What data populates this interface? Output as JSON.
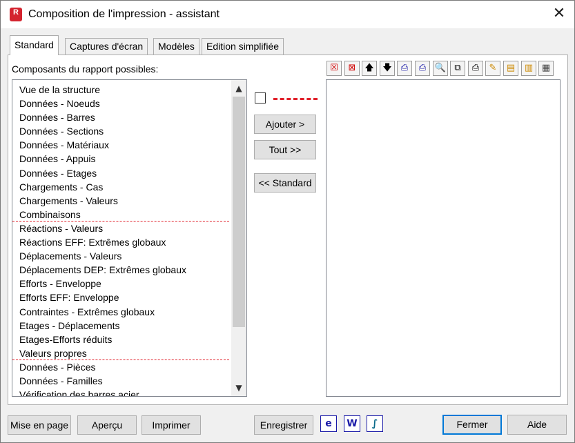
{
  "window": {
    "title": "Composition de l'impression - assistant",
    "app_icon_letter": "R",
    "close_glyph": "✕"
  },
  "tabs": [
    {
      "label": "Standard",
      "active": true
    },
    {
      "label": "Captures d'écran",
      "active": false
    },
    {
      "label": "Modèles",
      "active": false
    },
    {
      "label": "Edition simplifiée",
      "active": false
    }
  ],
  "available": {
    "label": "Composants du rapport possibles:",
    "items": [
      "Vue de la structure",
      "Données - Noeuds",
      "Données - Barres",
      "Données - Sections",
      "Données - Matériaux",
      "Données - Appuis",
      "Données - Etages",
      "Chargements - Cas",
      "Chargements - Valeurs",
      "Combinaisons",
      "Réactions - Valeurs",
      "Réactions EFF: Extrêmes globaux",
      "Déplacements - Valeurs",
      "Déplacements DEP: Extrêmes globaux",
      "Efforts - Enveloppe",
      "Efforts EFF: Enveloppe",
      "Contraintes - Extrêmes globaux",
      "Etages - Déplacements",
      "Etages-Efforts réduits",
      "Valeurs propres",
      "Données - Pièces",
      "Données - Familles",
      "Vérification des barres acier"
    ],
    "separator_after_indices": [
      9,
      19
    ]
  },
  "middle": {
    "add_label": "Ajouter >",
    "all_label": "Tout >>",
    "standard_label": "<< Standard"
  },
  "toolbar": {
    "icons": [
      {
        "name": "delete-icon",
        "glyph": "☒",
        "color": "#d00000"
      },
      {
        "name": "delete-all-icon",
        "glyph": "⊠",
        "color": "#d00000"
      },
      {
        "name": "move-up-icon",
        "glyph": "🡅",
        "color": "#000000"
      },
      {
        "name": "move-down-icon",
        "glyph": "🡇",
        "color": "#000000"
      },
      {
        "name": "print-selected-icon",
        "glyph": "⎙",
        "color": "#1a1aa8"
      },
      {
        "name": "print-remove-icon",
        "glyph": "⎙",
        "color": "#1a1aa8"
      },
      {
        "name": "preview-icon",
        "glyph": "🔍",
        "color": "#1a1aa8"
      },
      {
        "name": "page-setup-icon",
        "glyph": "⧉",
        "color": "#000000"
      },
      {
        "name": "printer-icon",
        "glyph": "⎙",
        "color": "#000000"
      },
      {
        "name": "edit-icon",
        "glyph": "✎",
        "color": "#cc8800"
      },
      {
        "name": "header-icon",
        "glyph": "▤",
        "color": "#cc8800"
      },
      {
        "name": "footer-icon",
        "glyph": "▥",
        "color": "#cc8800"
      },
      {
        "name": "page-icon",
        "glyph": "▦",
        "color": "#444444"
      }
    ]
  },
  "bottom": {
    "page_setup_label": "Mise en page",
    "preview_label": "Aperçu",
    "print_label": "Imprimer",
    "save_label": "Enregistrer",
    "close_label": "Fermer",
    "help_label": "Aide",
    "export_icons": [
      {
        "name": "html-export-icon",
        "glyph": "e",
        "color": "#1a1aa8"
      },
      {
        "name": "word-export-icon",
        "glyph": "W",
        "color": "#1a1aa8"
      },
      {
        "name": "excel-export-icon",
        "glyph": "∫",
        "color": "#0a6a8a"
      }
    ]
  },
  "colors": {
    "separator": "#e0202a",
    "focus_border": "#0078d7"
  }
}
